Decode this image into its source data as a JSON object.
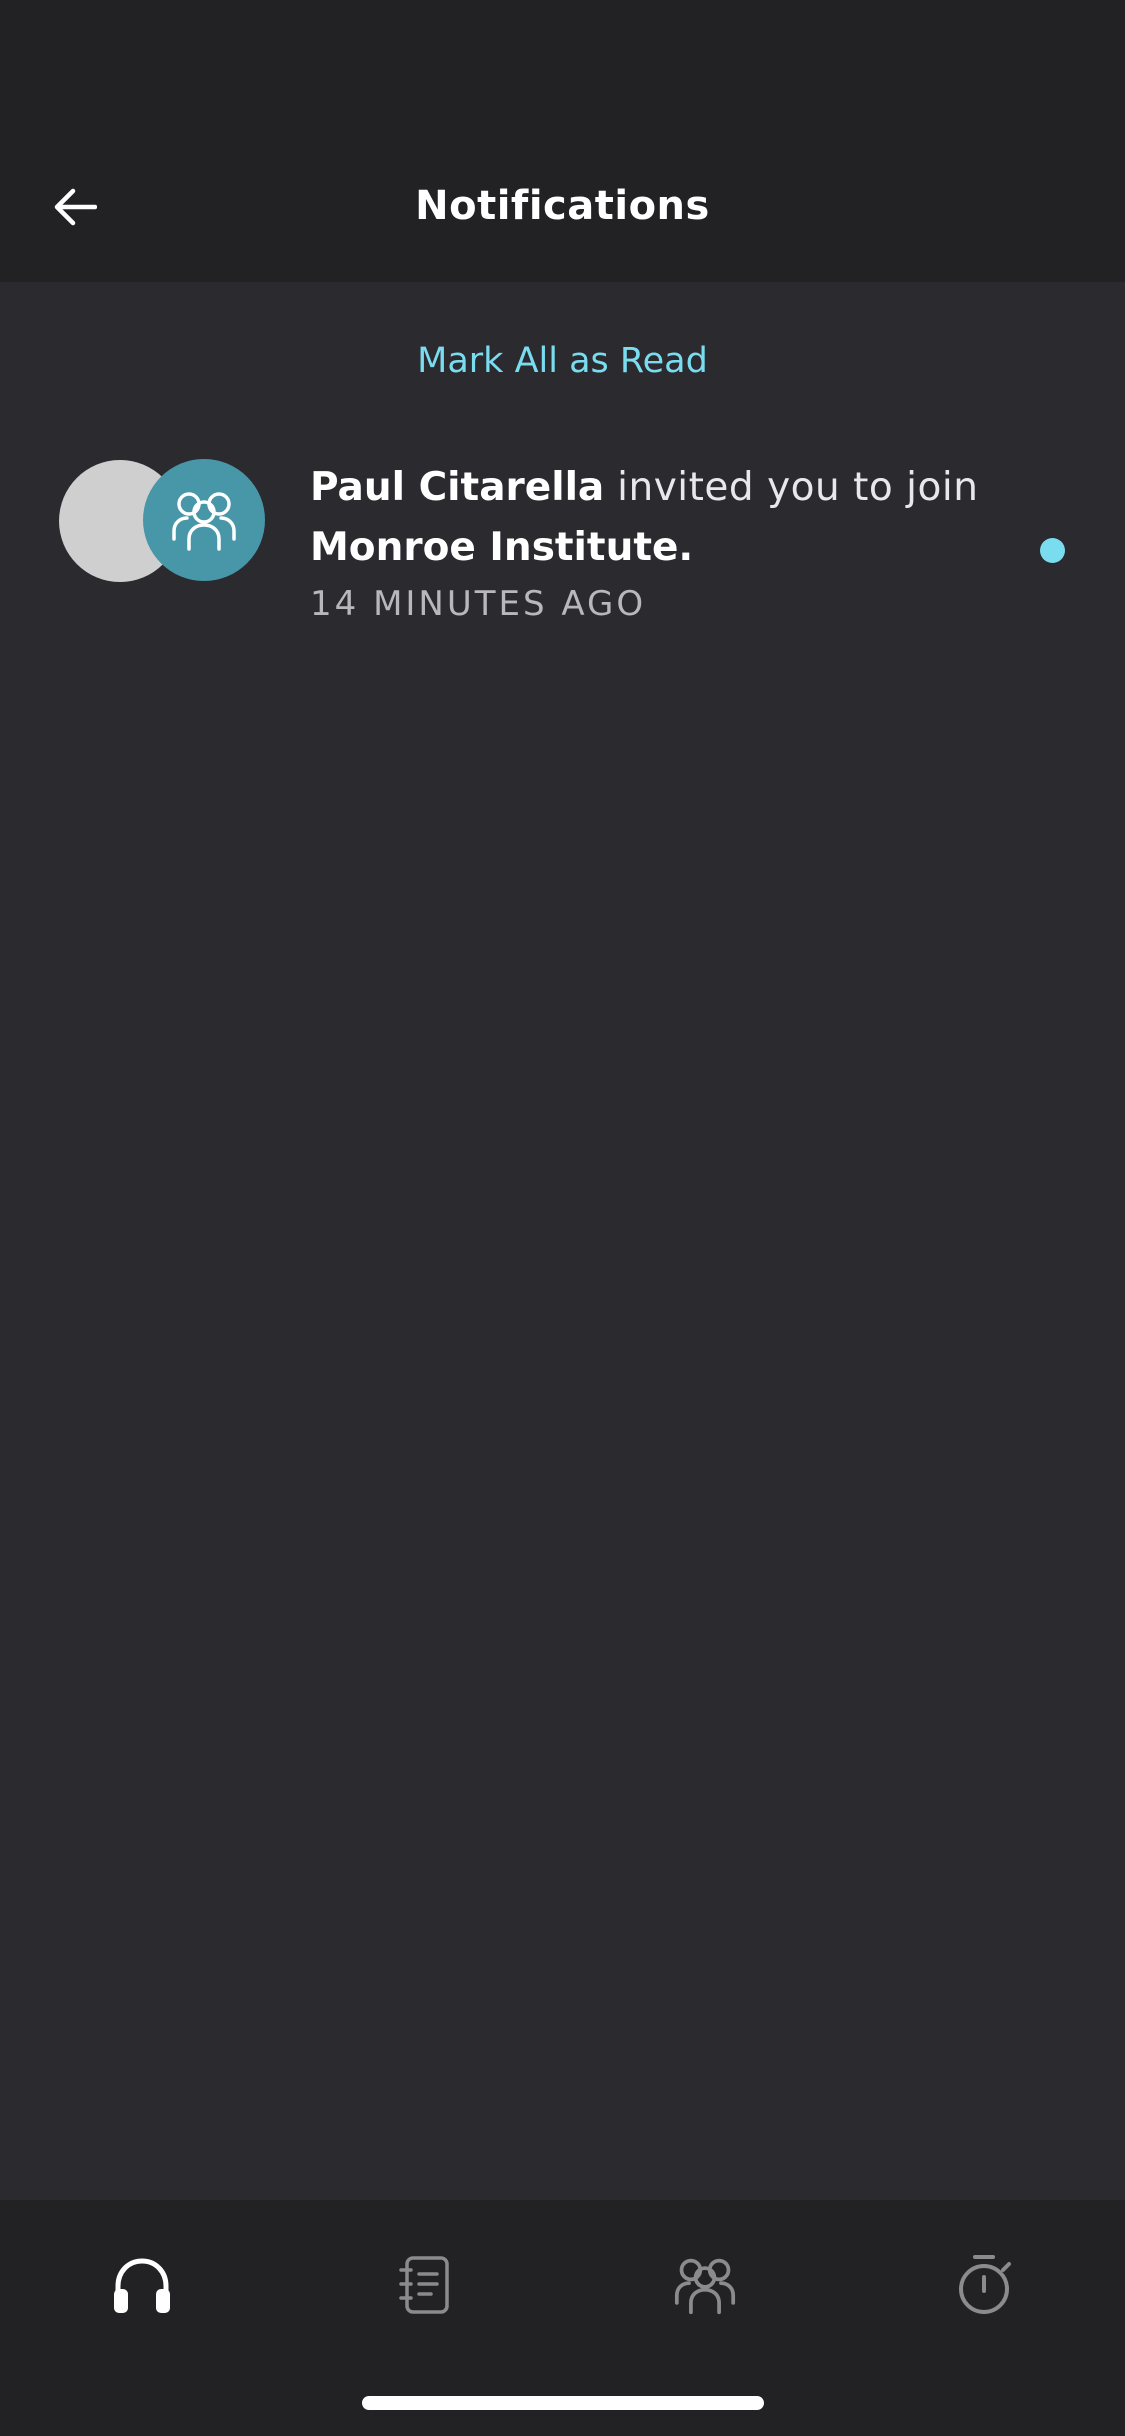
{
  "header": {
    "title": "Notifications",
    "back_icon": "arrow-left-icon"
  },
  "actions": {
    "mark_all_label": "Mark All as Read"
  },
  "notifications": [
    {
      "actor": "Paul Citarella",
      "message": " invited you to join ",
      "target": "Monroe Institute.",
      "time": "14 MINUTES AGO",
      "unread": true,
      "group_icon": "group-icon"
    }
  ],
  "tabbar": {
    "tabs": [
      {
        "icon": "headphones-icon",
        "active": true
      },
      {
        "icon": "journal-icon",
        "active": false
      },
      {
        "icon": "group-icon",
        "active": false
      },
      {
        "icon": "stopwatch-icon",
        "active": false
      }
    ]
  },
  "colors": {
    "accent": "#7adcef",
    "background": "#2b2a2f",
    "header": "#222225",
    "group_avatar": "#4797a9"
  }
}
